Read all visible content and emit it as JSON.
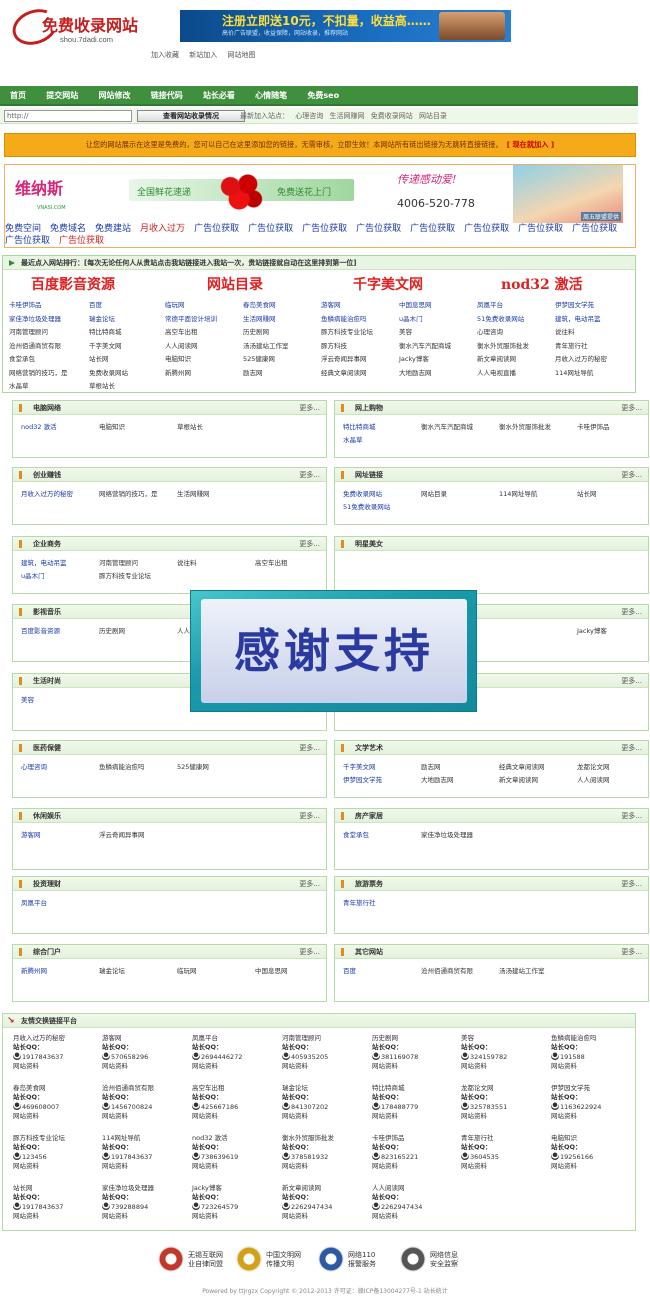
{
  "header": {
    "logo_title": "免费收录网站",
    "logo_url": "shou.7dadi.com",
    "banner_title": "注册立即送10元，不扣量，收益高……",
    "banner_sub": "高价广告联盟，收益保障，网站收录，推荐网站",
    "links": [
      "加入收藏",
      "新站加入",
      "网站地图"
    ]
  },
  "nav": [
    "首页",
    "提交网站",
    "网站修改",
    "链接代码",
    "站长必看",
    "心情随笔",
    "免费seo"
  ],
  "search": {
    "value": "http://",
    "button": "查看网站收录情况",
    "latest_label": "最新加入站点：",
    "latest": [
      "心理咨询",
      "生活网赚网",
      "免费收录网站",
      "网站目录"
    ]
  },
  "notice": {
    "text": "让您的网站展示在这里是免费的，您可以自己在这里添加您的链接，无需审核，立即生效！本网站所有链出链接为无跳转直接链接。",
    "join": "[ 现在就加入 ]"
  },
  "ads": {
    "ad1_brand": "维纳斯",
    "ad1_url": "VNASI.COM",
    "ad2_left": "全国鲜花速递",
    "ad2_right": "免费送花上门",
    "ad3_slogan": "传递感动爱!",
    "ad3_phone": "4006-520-778",
    "ad4_tag": "周五联盟提供",
    "links": [
      "免费空间",
      "免费域名",
      "免费建站",
      "月收入过万",
      "广告位获取",
      "广告位获取",
      "广告位获取",
      "广告位获取",
      "广告位获取",
      "广告位获取",
      "广告位获取",
      "广告位获取",
      "广告位获取",
      "广告位获取"
    ]
  },
  "rank": {
    "title": "最近点入网站排行：[每次无论任何人从贵站点击我站链接进入我站一次，贵站链接就自动在这里排到第一位]",
    "big": [
      "百度影音资源",
      "网站目录",
      "千字美文网",
      "nod32 激活"
    ],
    "rows": [
      [
        "卡哇伊饰品",
        "百度",
        "临玩网",
        "春岛美食网",
        "游客网",
        "中国息思网",
        "凤凰平台",
        "伊梦园文学苑"
      ],
      [
        "家佳净垃圾处理器",
        "瑞金论坛",
        "常德平面设计培训",
        "生活网赚网",
        "鱼鳞病能治愈吗",
        "u晶木门",
        "51免费收录网站",
        "建筑，电动吊篮"
      ],
      [
        "河南管理顾问",
        "特比特商城",
        "高空车出租",
        "历史剧网",
        "豚方科技专业论坛",
        "美容",
        "心理咨询",
        "说往料"
      ],
      [
        "沧州佰通商贸有限",
        "千字美文网",
        "人人阅读网",
        "汤汤建站工作室",
        "豚方科技",
        "衡水汽车汽配商城",
        "衡水外贸服饰批发",
        "青年旅行社"
      ],
      [
        "食堂承包",
        "站长网",
        "电脑知识",
        "525健康网",
        "浮云奇闻异事网",
        "Jacky博客",
        "新文章阅读网",
        "月收入过万的秘密"
      ],
      [
        "网络营销的技巧，是",
        "免费收录网站",
        "新腾州网",
        "励志网",
        "经典文章阅读网",
        "大地励志网",
        "人人电视直播",
        "114网址导航"
      ],
      [
        "水晶草",
        "草根站长"
      ]
    ]
  },
  "categories": [
    {
      "title": "电脑网络",
      "more": "更多...",
      "items": [
        [
          "nod32 激活",
          "电脑知识",
          "草根站长"
        ]
      ]
    },
    {
      "title": "网上购物",
      "more": "更多...",
      "items": [
        [
          "特比特商城",
          "衡水汽车汽配商城",
          "衡水外贸服饰批发",
          "卡哇伊饰品"
        ],
        [
          "水晶草"
        ]
      ]
    },
    {
      "title": "创业赚钱",
      "more": "更多...",
      "items": [
        [
          "月收入过万的秘密",
          "网络营销的技巧，是",
          "生活网赚网"
        ]
      ]
    },
    {
      "title": "网址链接",
      "more": "更多...",
      "items": [
        [
          "免费收录网站",
          "网站目录",
          "114网址导航",
          "站长网"
        ],
        [
          "51免费收录网站"
        ]
      ]
    },
    {
      "title": "企业商务",
      "more": "更多...",
      "items": [
        [
          "建筑，电动吊篮",
          "河南管理顾问",
          "说往料",
          "高空车出租"
        ],
        [
          "u晶木门",
          "豚方科技专业论坛"
        ]
      ]
    },
    {
      "title": "明星美女",
      "more": "",
      "items": []
    },
    {
      "title": "影视音乐",
      "more": "",
      "items": [
        [
          "百度影音资源",
          "历史剧网",
          "人人"
        ]
      ]
    },
    {
      "title": "",
      "more": "更多...",
      "items": [
        [
          "",
          "",
          "",
          "Jacky博客"
        ]
      ]
    },
    {
      "title": "生活时尚",
      "more": "",
      "items": [
        [
          "美容"
        ]
      ]
    },
    {
      "title": "",
      "more": "更多...",
      "items": []
    },
    {
      "title": "医药保健",
      "more": "更多...",
      "items": [
        [
          "心理咨询",
          "鱼鳞病能治愈吗",
          "525健康网"
        ]
      ]
    },
    {
      "title": "文学艺术",
      "more": "更多...",
      "items": [
        [
          "千字美文网",
          "励志网",
          "经典文章阅读网",
          "龙都论文网"
        ],
        [
          "伊梦园文学苑",
          "大地励志网",
          "新文章阅读网",
          "人人阅读网"
        ]
      ]
    },
    {
      "title": "休闲娱乐",
      "more": "更多...",
      "items": [
        [
          "游客网",
          "浮云奇闻异事网"
        ]
      ]
    },
    {
      "title": "房产家居",
      "more": "更多...",
      "items": [
        [
          "食堂承包",
          "家佳净垃圾处理器"
        ]
      ]
    },
    {
      "title": "投资理财",
      "more": "更多...",
      "items": [
        [
          "凤凰平台"
        ]
      ]
    },
    {
      "title": "旅游票务",
      "more": "更多...",
      "items": [
        [
          "青年旅行社"
        ]
      ]
    },
    {
      "title": "综合门户",
      "more": "更多...",
      "items": [
        [
          "新腾州网",
          "瑞金论坛",
          "临玩网",
          "中国息思网"
        ]
      ]
    },
    {
      "title": "其它网站",
      "more": "更多...",
      "items": [
        [
          "百度",
          "沧州佰通商贸有限",
          "汤汤建站工作室"
        ]
      ]
    }
  ],
  "overlay_text": "感谢支持",
  "friend": {
    "title": "友情交换链接平台",
    "qq_label": "站长QQ：",
    "info": "网站资料",
    "cells": [
      {
        "name": "月收入过万的秘密",
        "qq": "1917843637"
      },
      {
        "name": "游客网",
        "qq": "570658296"
      },
      {
        "name": "凤凰平台",
        "qq": "2694446272"
      },
      {
        "name": "河南管理顾问",
        "qq": "405935205"
      },
      {
        "name": "历史剧网",
        "qq": "381169078"
      },
      {
        "name": "美容",
        "qq": "324159782"
      },
      {
        "name": "鱼鳞病能治愈吗",
        "qq": "191588"
      },
      {
        "name": "春岛美食网",
        "qq": "469608007"
      },
      {
        "name": "沧州佰通商贸有限",
        "qq": "1456700824"
      },
      {
        "name": "高空车出租",
        "qq": "425667186"
      },
      {
        "name": "瑞金论坛",
        "qq": "841307202"
      },
      {
        "name": "特比特商城",
        "qq": "178488779"
      },
      {
        "name": "龙都论文网",
        "qq": "325783551"
      },
      {
        "name": "伊梦园文学苑",
        "qq": "1163622924"
      },
      {
        "name": "豚方科技专业论坛",
        "qq": "123456"
      },
      {
        "name": "114网址导航",
        "qq": "1917843637"
      },
      {
        "name": "nod32 激活",
        "qq": "738639619"
      },
      {
        "name": "衡水外贸服饰批发",
        "qq": "378581932"
      },
      {
        "name": "卡哇伊饰品",
        "qq": "823165221"
      },
      {
        "name": "青年旅行社",
        "qq": "3604535"
      },
      {
        "name": "电脑知识",
        "qq": "19256166"
      },
      {
        "name": "站长网",
        "qq": "1917843637"
      },
      {
        "name": "家佳净垃圾处理器",
        "qq": "739288894"
      },
      {
        "name": "Jacky博客",
        "qq": "723264579"
      },
      {
        "name": "新文章阅读网",
        "qq": "2262947434"
      },
      {
        "name": "人人阅读网",
        "qq": "2262947434"
      }
    ]
  },
  "footer": {
    "badges": [
      {
        "l1": "无锡互联网",
        "l2": "业自律同盟",
        "color": "#c0392b",
        "icon": "alliance-badge-icon"
      },
      {
        "l1": "中国文明网",
        "l2": "传播文明",
        "color": "#d4a017",
        "icon": "civilization-badge-icon"
      },
      {
        "l1": "网络110",
        "l2": "报警服务",
        "color": "#2c5aa0",
        "icon": "police-badge-icon"
      },
      {
        "l1": "网络信息",
        "l2": "安全监察",
        "color": "#555555",
        "icon": "security-badge-icon"
      }
    ],
    "copyright": "Powered by ttjrgzx Copyright © 2012-2013 许可证：赣ICP备13004277号-1 站长统计"
  }
}
